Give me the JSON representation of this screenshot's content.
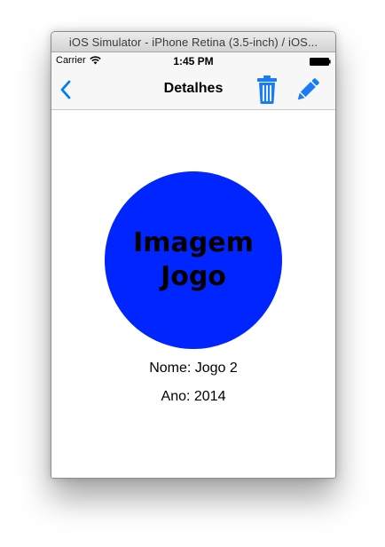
{
  "window": {
    "title": "iOS Simulator - iPhone Retina (3.5-inch) / iOS..."
  },
  "status_bar": {
    "carrier": "Carrier",
    "time": "1:45 PM"
  },
  "navbar": {
    "title": "Detalhes",
    "back_icon": "chevron-left-icon",
    "delete_icon": "trash-icon",
    "edit_icon": "pencil-icon"
  },
  "detail": {
    "image_text": "Imagem\nJogo",
    "name_line": "Nome: Jogo 2",
    "year_line": "Ano: 2014"
  },
  "colors": {
    "tint": "#007aff",
    "image_circle": "#0025ff"
  }
}
